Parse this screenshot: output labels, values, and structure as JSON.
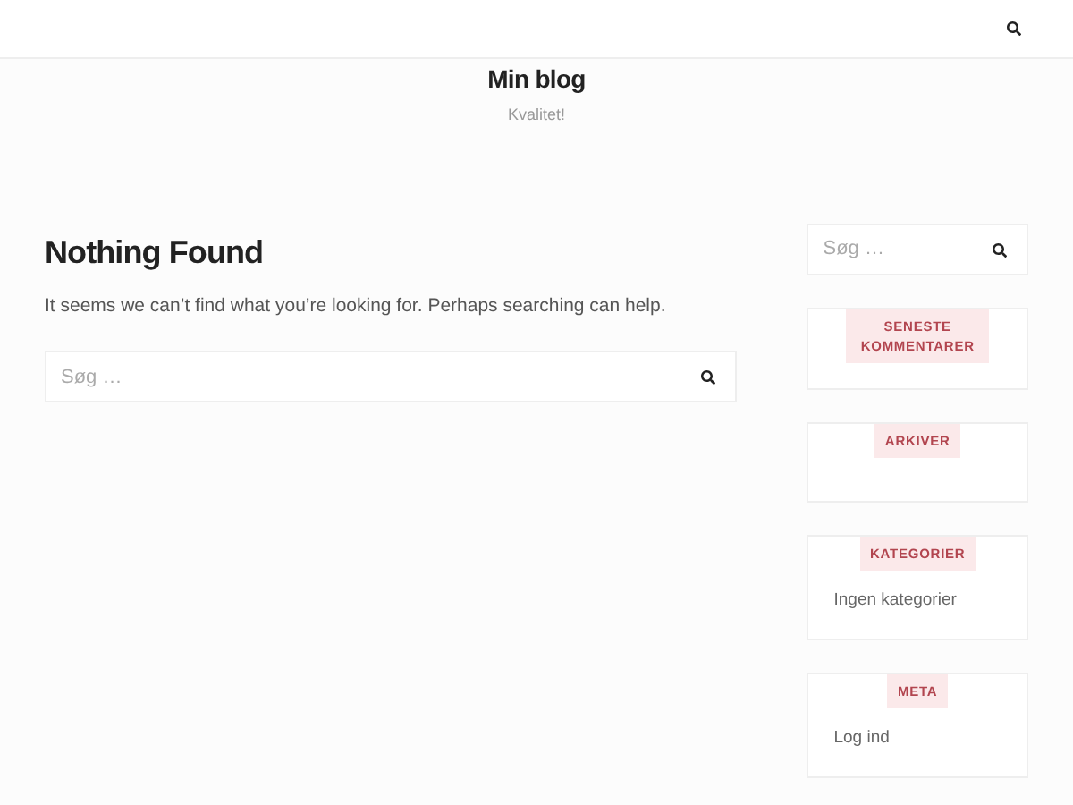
{
  "header": {
    "site_title": "Min blog",
    "tagline": "Kvalitet!"
  },
  "main": {
    "heading": "Nothing Found",
    "message": "It seems we can’t find what you’re looking for. Perhaps searching can help.",
    "search": {
      "placeholder": "Søg …"
    }
  },
  "sidebar": {
    "search": {
      "placeholder": "Søg …"
    },
    "widgets": [
      {
        "title": "SENESTE KOMMENTARER"
      },
      {
        "title": "ARKIVER"
      },
      {
        "title": "KATEGORIER",
        "items": [
          "Ingen kategorier"
        ]
      },
      {
        "title": "META",
        "items": [
          "Log ind"
        ]
      }
    ]
  }
}
